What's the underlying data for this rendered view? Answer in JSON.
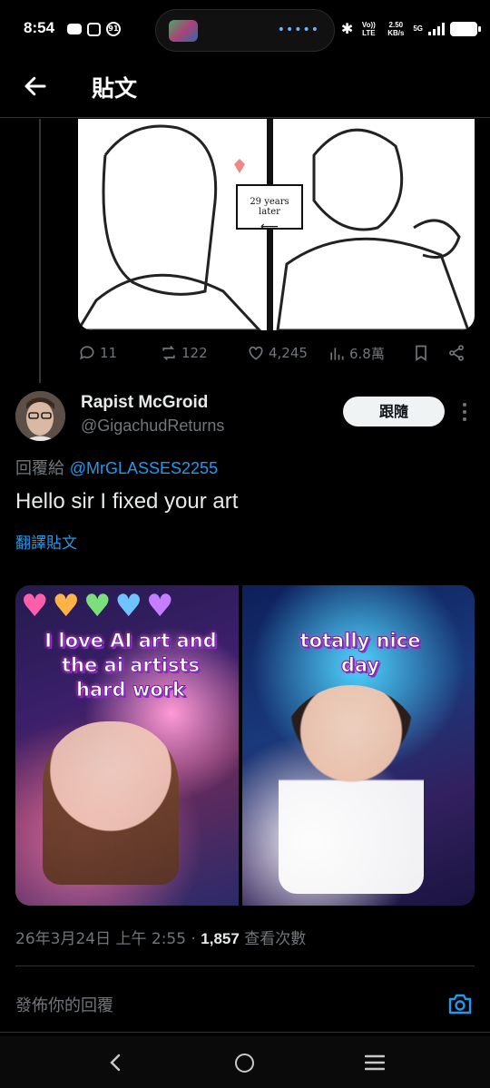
{
  "status_bar": {
    "time": "8:54",
    "notification_badge": "91",
    "volte": "Vo)) LTE",
    "speed": "2.50 KB/s",
    "network": "5G"
  },
  "header": {
    "title": "貼文"
  },
  "parent_post": {
    "panel_caption": "29 years later",
    "actions": {
      "replies": "11",
      "reposts": "122",
      "likes": "4,245",
      "views": "6.8萬"
    }
  },
  "reply": {
    "author_name": "Rapist McGroid",
    "author_handle": "@GigachudReturns",
    "follow_label": "跟隨",
    "replying_prefix": "回覆給",
    "replying_to": "@MrGLASSES2255",
    "text": "Hello sir I fixed your art",
    "translate_label": "翻譯貼文",
    "media": {
      "left_caption": "I love AI art and the ai artists hard work",
      "right_caption": "totally nice day"
    },
    "timestamp": "26年3月24日 上午 2:55 · ",
    "views_count": "1,857",
    "views_label": " 查看次數"
  },
  "composer": {
    "placeholder": "發佈你的回覆"
  },
  "colors": {
    "accent": "#1d9bf0",
    "background": "#000000",
    "muted": "#71767b"
  }
}
